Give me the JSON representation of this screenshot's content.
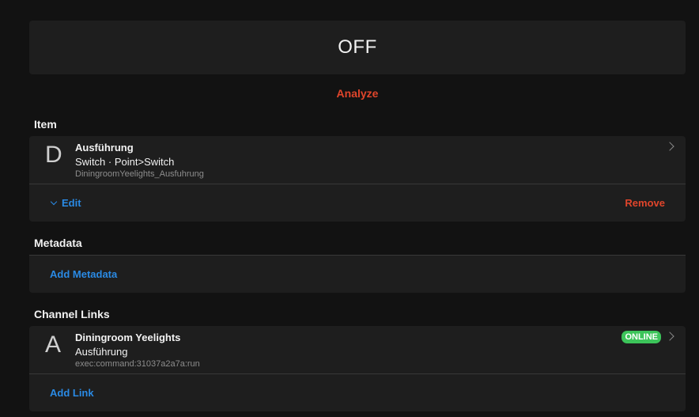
{
  "state": {
    "value": "OFF"
  },
  "analyze": {
    "label": "Analyze"
  },
  "item_section": {
    "title": "Item",
    "item": {
      "letter": "D",
      "label": "Ausführung",
      "type": "Switch · Point>Switch",
      "name": "DiningroomYeelights_Ausfuhrung"
    },
    "edit_label": "Edit",
    "remove_label": "Remove"
  },
  "metadata_section": {
    "title": "Metadata",
    "add_label": "Add Metadata"
  },
  "links_section": {
    "title": "Channel Links",
    "link": {
      "letter": "A",
      "thing": "Diningroom Yeelights",
      "channel": "Ausführung",
      "uid": "exec:command:31037a2a7a:run",
      "status": "ONLINE"
    },
    "add_label": "Add Link"
  },
  "colors": {
    "accent_blue": "#2a8ae4",
    "danger_red": "#e0452b",
    "online_green": "#3cc45a",
    "background": "#121212",
    "card": "#1e1e1e"
  }
}
